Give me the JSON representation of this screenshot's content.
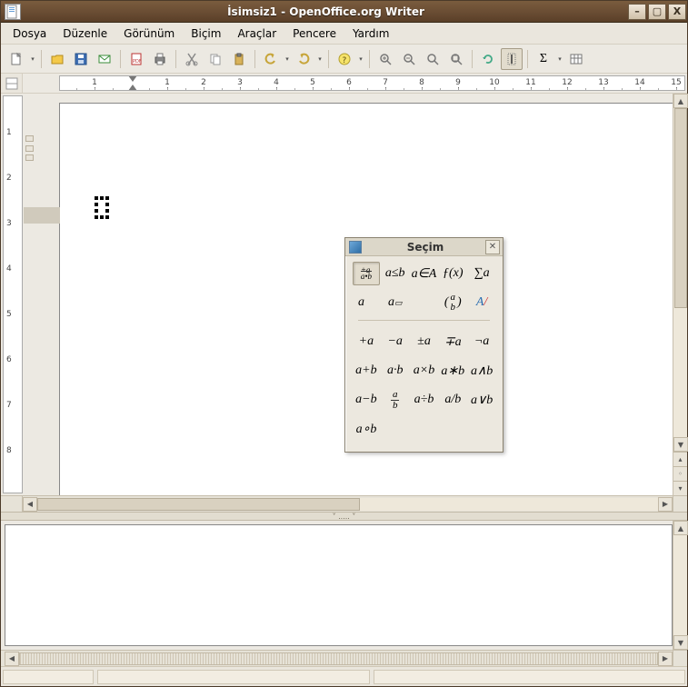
{
  "window": {
    "title": "İsimsiz1 - OpenOffice.org Writer",
    "min_label": "–",
    "max_label": "▢",
    "close_label": "X"
  },
  "menubar": {
    "items": [
      "Dosya",
      "Düzenle",
      "Görünüm",
      "Biçim",
      "Araçlar",
      "Pencere",
      "Yardım"
    ]
  },
  "toolbar": {
    "new_label": "Yeni",
    "open_label": "Aç",
    "save_label": "Kaydet",
    "mail_label": "E-posta",
    "pdf_label": "PDF",
    "print_label": "Yazdır",
    "cut_label": "Kes",
    "copy_label": "Kopyala",
    "paste_label": "Yapıştır",
    "undo_label": "Geri al",
    "redo_label": "Yinele",
    "help_label": "Yardım",
    "zoomin_label": "Yakınlaştır",
    "zoomout_label": "Uzaklaştır",
    "zoom100_label": "%100",
    "zoomall_label": "Tümü",
    "refresh_label": "Yenile",
    "cursor_label": "İmleç",
    "sigma_label": "Sigma",
    "table_label": "Tablo"
  },
  "ruler": {
    "h_numbers": [
      1,
      1,
      2,
      3,
      4,
      5,
      6,
      7,
      8,
      9,
      10,
      11,
      12,
      13,
      14,
      15
    ],
    "v_numbers": [
      1,
      2,
      3,
      4,
      5,
      6,
      7,
      8
    ]
  },
  "palette": {
    "title": "Seçim",
    "row1": [
      {
        "id": "unary-binary",
        "label_html": "<span style='font-size:9px;line-height:0.8'>+a<br><span style='border-top:1px solid #333'>a•b</span></span>",
        "active": true
      },
      {
        "id": "relations",
        "label_html": "a≤b"
      },
      {
        "id": "set-ops",
        "label_html": "a∈A"
      },
      {
        "id": "functions",
        "label_html": "ƒ(x)"
      },
      {
        "id": "operators",
        "label_html": "<span class='sigma'>∑</span>a"
      }
    ],
    "row2": [
      {
        "id": "vectors",
        "label_html": "a⃗"
      },
      {
        "id": "attributes",
        "label_html": "a<span class='sup'>▭</span>"
      },
      {
        "id": "spacer1",
        "label_html": "",
        "spacer": true
      },
      {
        "id": "brackets",
        "label_html": "(<span class='frac'><span class='fn' style='border:0'>a</span><span>b</span></span>)"
      },
      {
        "id": "formats",
        "label_html": "<span style='color:#2a6db0'>A</span><span style='color:#c33'>/</span>"
      }
    ],
    "row3": [
      {
        "id": "plus-a",
        "label_html": "+a"
      },
      {
        "id": "minus-a",
        "label_html": "−a"
      },
      {
        "id": "plusminus-a",
        "label_html": "±a"
      },
      {
        "id": "minusplus-a",
        "label_html": "∓a"
      },
      {
        "id": "not-a",
        "label_html": "¬a"
      }
    ],
    "row4": [
      {
        "id": "a-plus-b",
        "label_html": "a+b"
      },
      {
        "id": "a-dot-b",
        "label_html": "a·b"
      },
      {
        "id": "a-times-b",
        "label_html": "a×b"
      },
      {
        "id": "a-star-b",
        "label_html": "a∗b"
      },
      {
        "id": "a-and-b",
        "label_html": "a∧b"
      }
    ],
    "row5": [
      {
        "id": "a-minus-b",
        "label_html": "a−b"
      },
      {
        "id": "a-over-b",
        "label_html": "<span class='frac'><span class='fn'>a</span><span>b</span></span>"
      },
      {
        "id": "a-div-b",
        "label_html": "a÷b"
      },
      {
        "id": "a-slash-b",
        "label_html": "a/b"
      },
      {
        "id": "a-or-b",
        "label_html": "a∨b"
      }
    ],
    "row6": [
      {
        "id": "a-circ-b",
        "label_html": "a∘b"
      }
    ]
  },
  "splitter": {
    "label": "˅ ..... ˅"
  },
  "status": {}
}
